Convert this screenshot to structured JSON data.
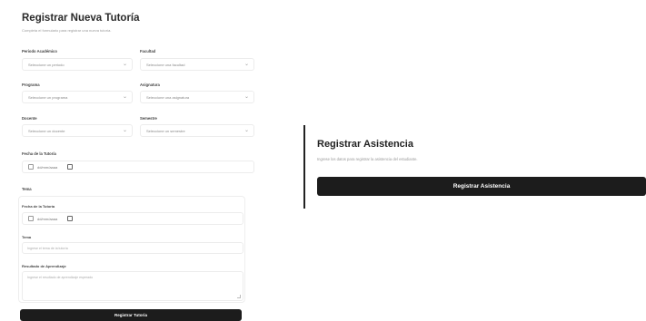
{
  "tutoria_form": {
    "title": "Registrar Nueva Tutoría",
    "subtitle": "Completa el formulario para registrar una nueva tutoría.",
    "fields": {
      "periodo": {
        "label": "Periodo Académico",
        "placeholder": "Seleccione un periodo"
      },
      "facultad": {
        "label": "Facultad",
        "placeholder": "Seleccione una facultad"
      },
      "programa": {
        "label": "Programa",
        "placeholder": "Seleccione un programa"
      },
      "asignatura": {
        "label": "Asignatura",
        "placeholder": "Seleccione una asignatura"
      },
      "docente": {
        "label": "Docente",
        "placeholder": "Seleccione un docente"
      },
      "semestre": {
        "label": "Semestre",
        "placeholder": "Seleccione un semestre"
      },
      "fecha": {
        "label": "Fecha de la Tutoría",
        "value": "dd/mm/aaaa"
      }
    },
    "tema_section": {
      "label": "Tema",
      "fecha_label": "Fecha de la Tutoría",
      "fecha_value": "dd/mm/aaaa",
      "tema_label": "Tema",
      "tema_placeholder": "Ingrese el tema de la tutoría",
      "resultado_label": "Resultado de Aprendizaje",
      "resultado_placeholder": "Ingrese el resultado de aprendizaje esperado"
    },
    "submit_label": "Registrar Tutoria"
  },
  "asistencia": {
    "title": "Registrar Asistencia",
    "subtitle": "Ingrese los datos para registrar la asistencia del estudiante.",
    "button_label": "Registrar Asistencia"
  },
  "icons": {
    "select_chevron": "chevron-down-icon",
    "calendar": "calendar-icon"
  }
}
